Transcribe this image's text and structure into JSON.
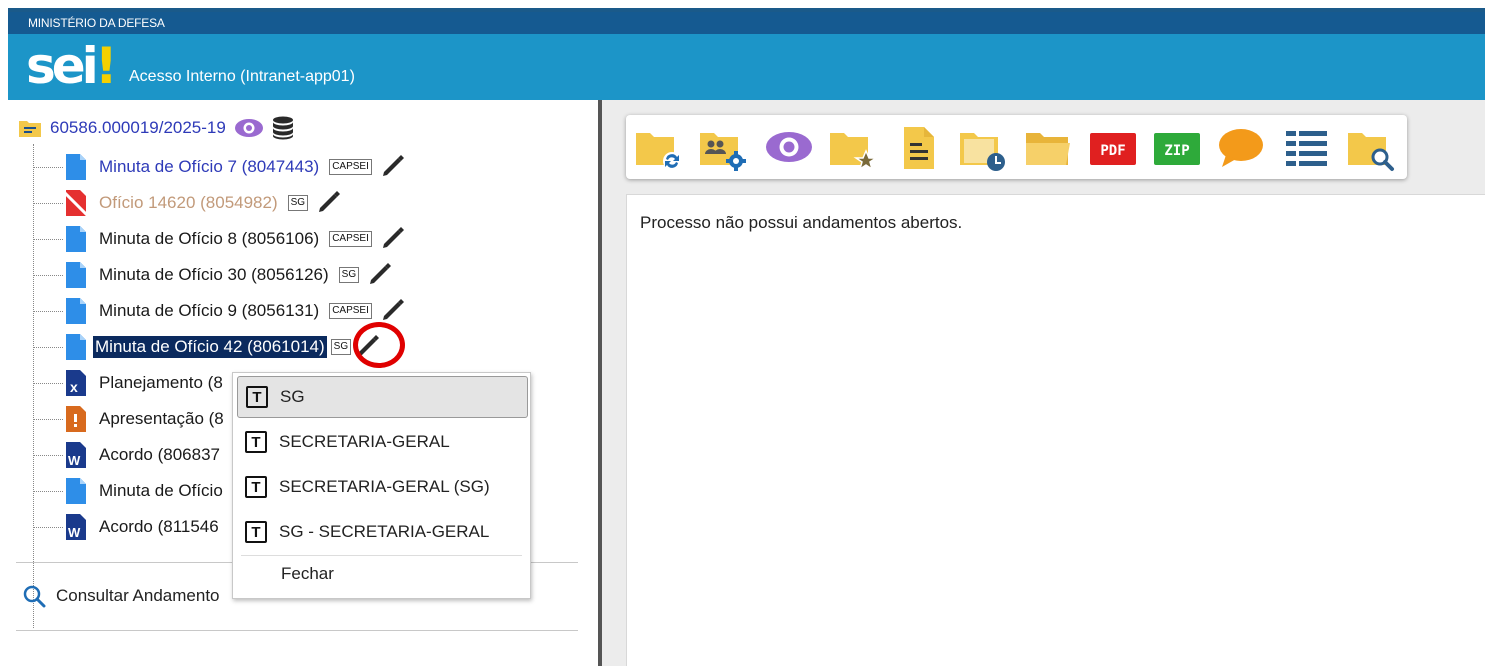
{
  "header": {
    "ministry": "MINISTÉRIO DA DEFESA",
    "logo_text": "sei",
    "logo_mark": "!",
    "app_name": "Acesso Interno (Intranet-app01)"
  },
  "process": {
    "number": "60586.000019/2025-19",
    "icons": [
      "folder-icon",
      "eye-icon",
      "database-icon"
    ]
  },
  "documents": [
    {
      "label": "Minuta de Ofício 7 (8047443)",
      "badge": "CAPSEI",
      "icon": "document-icon",
      "style": "blue"
    },
    {
      "label": "Ofício 14620 (8054982)",
      "badge": "SG",
      "icon": "document-cancelled-icon",
      "style": "faded"
    },
    {
      "label": "Minuta de Ofício 8 (8056106)",
      "badge": "CAPSEI",
      "icon": "document-icon",
      "style": "normal"
    },
    {
      "label": "Minuta de Ofício 30 (8056126)",
      "badge": "SG",
      "icon": "document-icon",
      "style": "normal"
    },
    {
      "label": "Minuta de Ofício 9 (8056131)",
      "badge": "CAPSEI",
      "icon": "document-icon",
      "style": "normal"
    },
    {
      "label": "Minuta de Ofício 42 (8061014)",
      "badge": "SG",
      "icon": "document-icon",
      "style": "selected"
    },
    {
      "label": "Planejamento (8",
      "badge": "",
      "icon": "excel-icon",
      "style": "normal"
    },
    {
      "label": "Apresentação (8",
      "badge": "",
      "icon": "presentation-icon",
      "style": "normal"
    },
    {
      "label": "Acordo (806837",
      "badge": "",
      "icon": "word-icon",
      "style": "normal"
    },
    {
      "label": "Minuta de Ofício",
      "badge": "",
      "icon": "document-icon",
      "style": "normal"
    },
    {
      "label": "Acordo (811546",
      "badge": "",
      "icon": "word-icon",
      "style": "normal"
    }
  ],
  "consult": {
    "label": "Consultar Andamento"
  },
  "popup": {
    "items": [
      {
        "icon": "T",
        "label": "SG"
      },
      {
        "icon": "T",
        "label": "SECRETARIA-GERAL"
      },
      {
        "icon": "T",
        "label": "SECRETARIA-GERAL (SG)"
      },
      {
        "icon": "T",
        "label": "SG - SECRETARIA-GERAL"
      }
    ],
    "close_label": "Fechar"
  },
  "toolbar": {
    "icons": [
      "folder-sync-icon",
      "folder-users-settings-icon",
      "eye-icon",
      "folder-star-icon",
      "document-note-icon",
      "folder-clock-icon",
      "folder-open-icon",
      "pdf-icon",
      "zip-icon",
      "comment-icon",
      "list-icon",
      "folder-search-icon"
    ],
    "pdf_text": "PDF",
    "zip_text": "ZIP"
  },
  "main": {
    "message": "Processo não possui andamentos abertos."
  },
  "colors": {
    "header_dark": "#155a91",
    "header_light": "#1c95c8",
    "link_blue": "#2e3ab8",
    "selected_bg": "#0b2a5e",
    "highlight_red": "#e00000"
  }
}
